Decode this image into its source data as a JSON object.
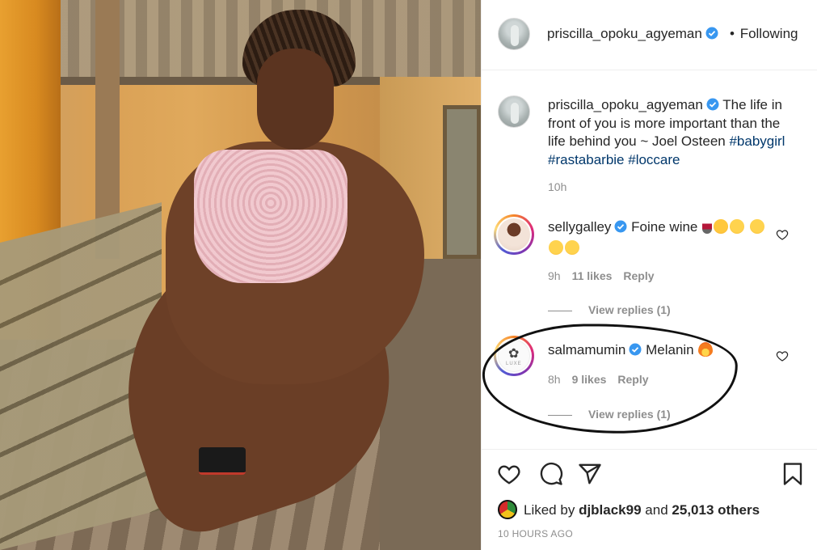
{
  "post": {
    "owner": "priscilla_opoku_agyeman",
    "follow_status": "Following",
    "follow_dot": "•"
  },
  "caption": {
    "username": "priscilla_opoku_agyeman",
    "text": "The life in front of you is more important than the life behind you ~ Joel Osteen",
    "hashtags": [
      "#babygirl",
      "#rastabarbie",
      "#loccare"
    ],
    "time": "10h"
  },
  "comments": [
    {
      "username": "sellygalley",
      "text": "Foine wine",
      "emojis": [
        "wine-glass-emoji",
        "smiling-hearts-emoji",
        "kiss-emoji",
        "kiss-emoji",
        "kiss-emoji",
        "kiss-emoji"
      ],
      "time": "9h",
      "likes": "11 likes",
      "reply": "Reply",
      "view_replies": "View replies (1)"
    },
    {
      "username": "salmamumin",
      "text": "Melanin",
      "emojis": [
        "fire-emoji"
      ],
      "time": "8h",
      "likes": "9 likes",
      "reply": "Reply",
      "view_replies": "View replies (1)"
    }
  ],
  "likes": {
    "prefix": "Liked by",
    "user": "djblack99",
    "conjunction": "and",
    "others": "25,013 others"
  },
  "timestamp": "10 HOURS AGO",
  "colors": {
    "link": "#00376b",
    "secondary_text": "#8e8e8e",
    "verified": "#3897f0"
  }
}
